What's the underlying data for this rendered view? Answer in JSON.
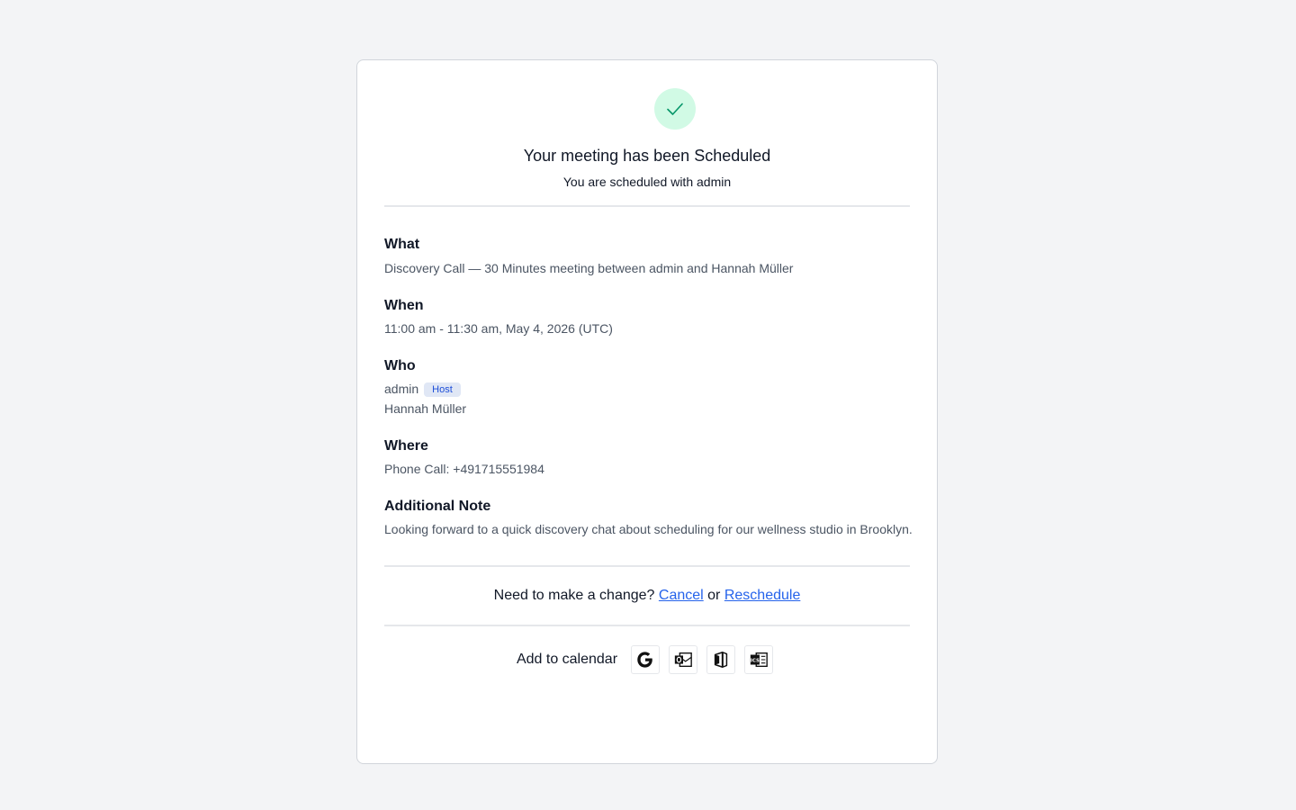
{
  "header": {
    "title": "Your meeting has been Scheduled",
    "subtitle": "You are scheduled with admin"
  },
  "details": {
    "what": {
      "label": "What",
      "value": "Discovery Call — 30 Minutes meeting between admin and Hannah Müller"
    },
    "when": {
      "label": "When",
      "value": "11:00 am - 11:30 am, May 4, 2026 (UTC)"
    },
    "who": {
      "label": "Who",
      "host_name": "admin",
      "host_badge": "Host",
      "attendee_name": "Hannah Müller"
    },
    "where": {
      "label": "Where",
      "value": "Phone Call: +491715551984"
    },
    "note": {
      "label": "Additional Note",
      "value": "Looking forward to a quick discovery chat about scheduling for our wellness studio in Brooklyn."
    }
  },
  "change": {
    "prompt": "Need to make a change?",
    "cancel_label": "Cancel",
    "or_text": "or",
    "reschedule_label": "Reschedule"
  },
  "calendar": {
    "label": "Add to calendar",
    "buttons": [
      {
        "icon": "google-calendar-icon"
      },
      {
        "icon": "outlook-calendar-icon"
      },
      {
        "icon": "office365-calendar-icon"
      },
      {
        "icon": "ics-download-icon"
      }
    ]
  },
  "colors": {
    "accent": "#2563eb",
    "success_bg": "#d1fae5",
    "success_check": "#059669",
    "badge_bg": "#e0e7f5",
    "badge_text": "#1d4ed8"
  }
}
